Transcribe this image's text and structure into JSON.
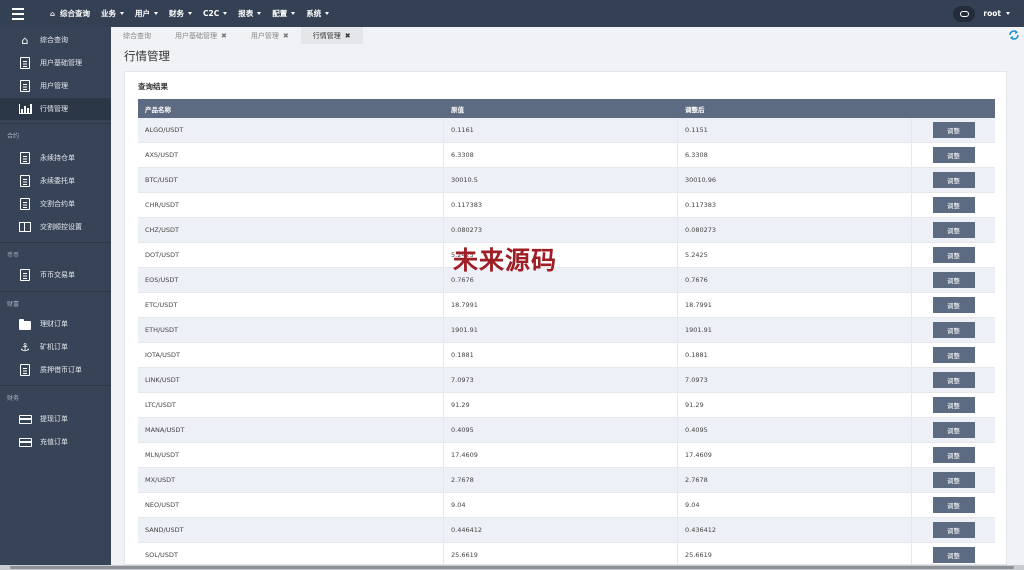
{
  "topbar": {
    "nav": [
      {
        "label": "综合查询",
        "home": true,
        "caret": false
      },
      {
        "label": "业务",
        "caret": true
      },
      {
        "label": "用户",
        "caret": true
      },
      {
        "label": "财务",
        "caret": true
      },
      {
        "label": "C2C",
        "caret": true
      },
      {
        "label": "报表",
        "caret": true
      },
      {
        "label": "配置",
        "caret": true
      },
      {
        "label": "系统",
        "caret": true
      }
    ],
    "username": "root"
  },
  "sidebar": {
    "top_items": [
      {
        "label": "综合查询",
        "icon": "home-icon"
      },
      {
        "label": "用户基础管理",
        "icon": "document-icon"
      },
      {
        "label": "用户管理",
        "icon": "document-icon"
      },
      {
        "label": "行情管理",
        "icon": "bar-chart-icon",
        "active": true
      }
    ],
    "contract": {
      "title": "合约",
      "items": [
        {
          "label": "永续持仓单",
          "icon": "document-icon"
        },
        {
          "label": "永续委托单",
          "icon": "document-icon"
        },
        {
          "label": "交割合约单",
          "icon": "document-icon"
        },
        {
          "label": "交割顺控设置",
          "icon": "columns-icon"
        }
      ]
    },
    "spot": {
      "title": "币币",
      "items": [
        {
          "label": "币币交易单",
          "icon": "document-icon"
        }
      ]
    },
    "wealth": {
      "title": "财富",
      "items": [
        {
          "label": "理财订单",
          "icon": "folder-icon"
        },
        {
          "label": "矿机订单",
          "icon": "anchor-icon"
        },
        {
          "label": "质押借币订单",
          "icon": "document-icon"
        }
      ]
    },
    "finance": {
      "title": "财务",
      "items": [
        {
          "label": "提现订单",
          "icon": "credit-card-icon"
        },
        {
          "label": "充值订单",
          "icon": "credit-card-icon"
        }
      ]
    }
  },
  "tabs": [
    {
      "label": "综合查询",
      "closable": false
    },
    {
      "label": "用户基础管理",
      "closable": true
    },
    {
      "label": "用户管理",
      "closable": true
    },
    {
      "label": "行情管理",
      "closable": true,
      "active": true
    }
  ],
  "page": {
    "title": "行情管理"
  },
  "results": {
    "title": "查询结果",
    "columns": [
      "产品名称",
      "原值",
      "调整后",
      ""
    ],
    "action_label": "调整",
    "rows": [
      {
        "name": "ALGO/USDT",
        "original": "0.1161",
        "adjusted": "0.1151"
      },
      {
        "name": "AXS/USDT",
        "original": "6.3308",
        "adjusted": "6.3308"
      },
      {
        "name": "BTC/USDT",
        "original": "30010.5",
        "adjusted": "30010.96"
      },
      {
        "name": "CHR/USDT",
        "original": "0.117383",
        "adjusted": "0.117383"
      },
      {
        "name": "CHZ/USDT",
        "original": "0.080273",
        "adjusted": "0.080273"
      },
      {
        "name": "DOT/USDT",
        "original": "5.2425",
        "adjusted": "5.2425"
      },
      {
        "name": "EOS/USDT",
        "original": "0.7676",
        "adjusted": "0.7676"
      },
      {
        "name": "ETC/USDT",
        "original": "18.7991",
        "adjusted": "18.7991"
      },
      {
        "name": "ETH/USDT",
        "original": "1901.91",
        "adjusted": "1901.91"
      },
      {
        "name": "IOTA/USDT",
        "original": "0.1881",
        "adjusted": "0.1881"
      },
      {
        "name": "LINK/USDT",
        "original": "7.0973",
        "adjusted": "7.0973"
      },
      {
        "name": "LTC/USDT",
        "original": "91.29",
        "adjusted": "91.29"
      },
      {
        "name": "MANA/USDT",
        "original": "0.4095",
        "adjusted": "0.4095"
      },
      {
        "name": "MLN/USDT",
        "original": "17.4609",
        "adjusted": "17.4609"
      },
      {
        "name": "MX/USDT",
        "original": "2.7678",
        "adjusted": "2.7678"
      },
      {
        "name": "NEO/USDT",
        "original": "9.04",
        "adjusted": "9.04"
      },
      {
        "name": "SAND/USDT",
        "original": "0.446412",
        "adjusted": "0.436412"
      },
      {
        "name": "SOL/USDT",
        "original": "25.6619",
        "adjusted": "25.6619"
      }
    ]
  },
  "watermark": "未来源码",
  "colors": {
    "topbar": "#344154",
    "sidebar": "#374458",
    "table_header": "#5c6b81",
    "button": "#5c6b81",
    "refresh": "#1a8fd4",
    "watermark": "#9e1e25"
  }
}
